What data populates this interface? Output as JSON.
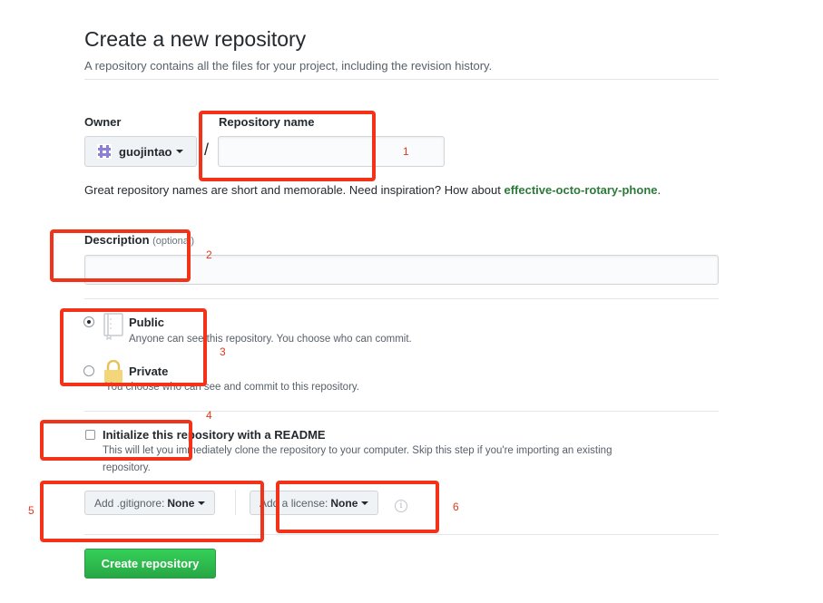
{
  "header": {
    "title": "Create a new repository",
    "subtitle": "A repository contains all the files for your project, including the revision history."
  },
  "owner": {
    "label": "Owner",
    "name": "guojintao"
  },
  "slash": "/",
  "repo_name": {
    "label": "Repository name",
    "value": "",
    "placeholder": ""
  },
  "hint": {
    "text": "Great repository names are short and memorable. Need inspiration? How about ",
    "suggestion": "effective-octo-rotary-phone",
    "end": "."
  },
  "description": {
    "label": "Description",
    "note": "(optional)",
    "value": ""
  },
  "visibility": {
    "selected": "public",
    "public": {
      "title": "Public",
      "desc": "Anyone can see this repository. You choose who can commit."
    },
    "private": {
      "title": "Private",
      "desc": "You choose who can see and commit to this repository."
    }
  },
  "readme": {
    "checked": false,
    "title": "Initialize this repository with a README",
    "desc_line1": "This will let you immediately clone the repository to your computer. Skip this step if you're importing an existing",
    "desc_line2": "repository."
  },
  "gitignore": {
    "prefix": "Add .gitignore:",
    "value": "None"
  },
  "license": {
    "prefix": "Add a license:",
    "value": "None"
  },
  "info_icon": "info-icon",
  "submit": {
    "label": "Create repository"
  },
  "annotations": [
    "1",
    "2",
    "3",
    "4",
    "5",
    "6"
  ],
  "colors": {
    "accent_green": "#28a745",
    "callout_red": "#f2331a",
    "suggestion_green": "#2c7a3a"
  }
}
